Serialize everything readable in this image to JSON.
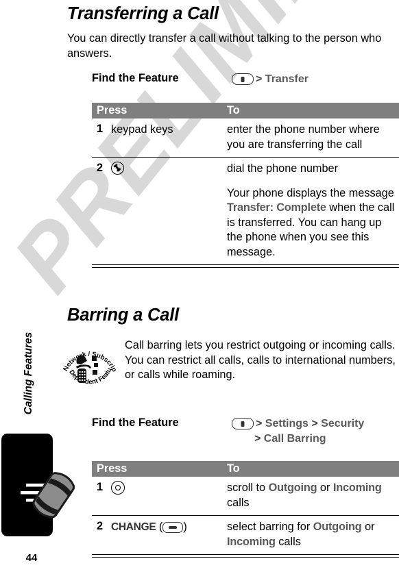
{
  "watermark": {
    "text": "PRELIMINARY"
  },
  "left_rail": {
    "chapter_label": "Calling Features",
    "page_number": "44",
    "tab_icon": "ringing-phone-handset-icon"
  },
  "sections": [
    {
      "id": "transferring-a-call",
      "heading": "Transferring a Call",
      "intro": "You can directly transfer a call without talking to the person who answers.",
      "find_the_feature": {
        "label": "Find the Feature",
        "key_icon": "menu-key-icon",
        "path_line1_sep": ">",
        "path_line1_item": "Transfer"
      },
      "table": {
        "col_press": "Press",
        "col_to": "To",
        "rows": [
          {
            "num": "1",
            "press_text": "keypad keys",
            "press_icon": "",
            "to_lines": [
              "enter the phone number where you are transferring the call"
            ]
          },
          {
            "num": "2",
            "press_text": "",
            "press_icon": "send-key-icon",
            "to_lines": [
              "dial the phone number"
            ],
            "to_note_pre": "Your phone displays the message ",
            "to_note_display": "Transfer: Complete",
            "to_note_post": " when the call is transferred. You can hang up the phone when you see this message."
          }
        ]
      }
    },
    {
      "id": "barring-a-call",
      "heading": "Barring a Call",
      "icon": "network-subscription-dependent-feature-icon",
      "icon_text_top": "Network / Subscription",
      "icon_text_bottom": "Dependent  Feature",
      "intro": "Call barring lets you restrict outgoing or incoming calls. You can restrict all calls, calls to international numbers, or calls while roaming.",
      "find_the_feature": {
        "label": "Find the Feature",
        "key_icon": "menu-key-icon",
        "sep": ">",
        "item1": "Settings",
        "item2": "Security",
        "item3": "Call Barring"
      },
      "table": {
        "col_press": "Press",
        "col_to": "To",
        "rows": [
          {
            "num": "1",
            "press_text": "",
            "press_icon": "navigation-key-icon",
            "to_pre": "scroll to ",
            "to_display1": "Outgoing",
            "to_mid": " or ",
            "to_display2": "Incoming",
            "to_post": " calls"
          },
          {
            "num": "2",
            "press_text": "CHANGE",
            "press_icon": "soft-key-icon",
            "to_pre": "select barring for ",
            "to_display1": "Outgoing",
            "to_mid": " or ",
            "to_display2": "Incoming",
            "to_post": " calls"
          }
        ]
      }
    }
  ],
  "colors": {
    "table_header_bg": "#7f7f7f",
    "display_text": "#595959",
    "watermark": "#d8d8d8",
    "tab_bg": "#000000",
    "handset": "#8c8c8c"
  }
}
